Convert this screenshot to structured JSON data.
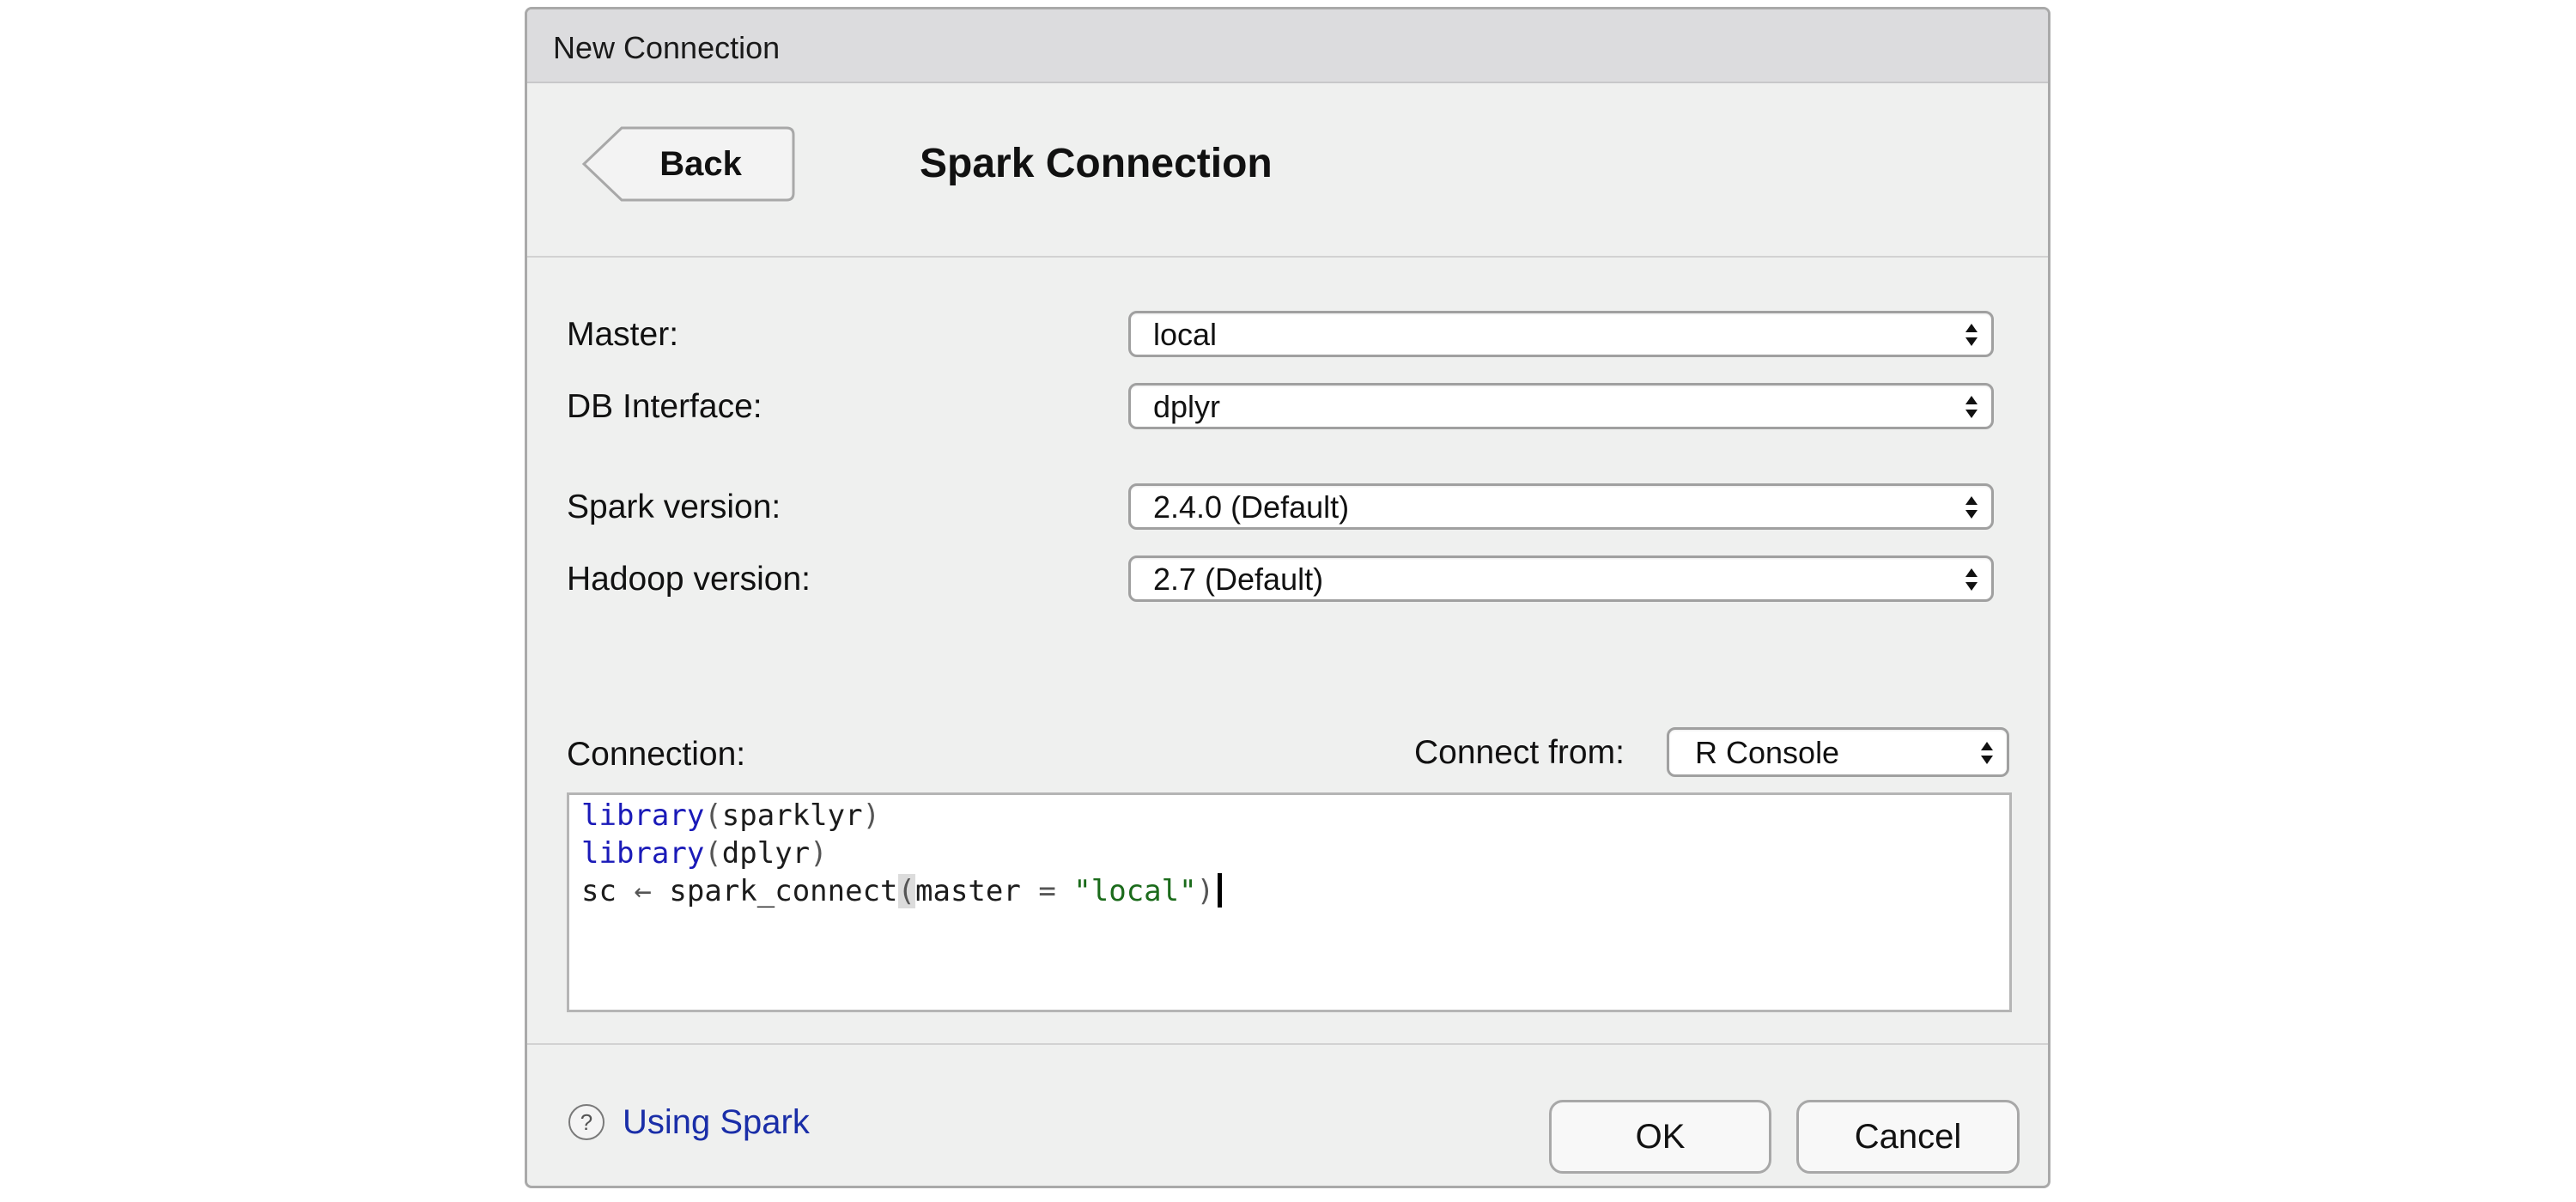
{
  "window": {
    "title": "New Connection"
  },
  "header": {
    "back_label": "Back",
    "title": "Spark Connection"
  },
  "form": {
    "master": {
      "label": "Master:",
      "value": "local"
    },
    "db_interface": {
      "label": "DB Interface:",
      "value": "dplyr"
    },
    "spark_version": {
      "label": "Spark version:",
      "value": "2.4.0 (Default)"
    },
    "hadoop_version": {
      "label": "Hadoop version:",
      "value": "2.7 (Default)"
    }
  },
  "connection": {
    "label": "Connection:",
    "connect_from_label": "Connect from:",
    "connect_from_value": "R Console",
    "code": {
      "line1": {
        "fn": "library",
        "open": "(",
        "arg": "sparklyr",
        "close": ")"
      },
      "line2": {
        "fn": "library",
        "open": "(",
        "arg": "dplyr",
        "close": ")"
      },
      "line3": {
        "lhs": "sc",
        "assign": "←",
        "fn": "spark_connect",
        "open": "(",
        "arg_name": "master",
        "eq": "=",
        "arg_value": "\"local\"",
        "close": ")"
      }
    }
  },
  "footer": {
    "help_icon": "?",
    "help_label": "Using Spark",
    "ok_label": "OK",
    "cancel_label": "Cancel"
  },
  "icons": {
    "back": "chevron-left-button-shape",
    "select_arrows": "updown-arrows-icon",
    "help": "question-circle-icon"
  },
  "colors": {
    "keyword": "#1a1ab8",
    "string": "#1b6b1b",
    "link": "#1a2ea8",
    "dialog_bg": "#eff0ef",
    "titlebar_bg": "#dcdcde"
  }
}
